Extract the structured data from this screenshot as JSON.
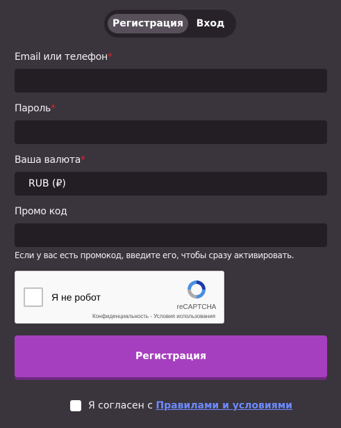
{
  "tabs": {
    "register": "Регистрация",
    "login": "Вход"
  },
  "form": {
    "email_label": "Email или телефон",
    "password_label": "Пароль",
    "currency_label": "Ваша валюта",
    "currency_value": "RUB (₽)",
    "promo_label": "Промо код",
    "promo_hint": "Если у вас есть промокод, введите его, чтобы сразу активировать.",
    "required_mark": "*"
  },
  "recaptcha": {
    "label": "Я не робот",
    "brand": "reCAPTCHA",
    "links": "Конфиденциальность - Условия использования"
  },
  "submit_label": "Регистрация",
  "agree": {
    "prefix": "Я согласен с",
    "link": "Правилами и условиями"
  },
  "colors": {
    "accent": "#a63fbf",
    "background": "#3a343c",
    "field": "#221e24",
    "link": "#6d8bff",
    "required": "#e0242a"
  },
  "icons": {
    "recaptcha": "recaptcha-logo-icon"
  }
}
